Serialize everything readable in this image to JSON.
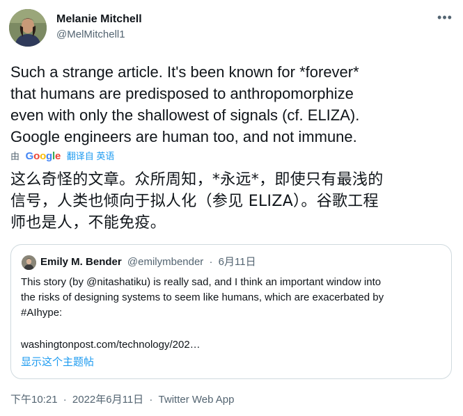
{
  "author": {
    "name": "Melanie Mitchell",
    "handle": "@MelMitchell1"
  },
  "more_glyph": "•••",
  "tweet": {
    "lines": [
      "Such a strange article.  It's been known for *forever*",
      "that humans are predisposed to anthropomorphize",
      "even with only the shallowest of signals (cf. ELIZA).",
      "Google engineers are human too, and not immune."
    ]
  },
  "translation": {
    "by": "由",
    "provider": "Google",
    "action": "翻译自 英语",
    "lines": [
      "这么奇怪的文章。众所周知，*永远*，即使只有最浅的",
      "信号，人类也倾向于拟人化（参见 ELIZA）。谷歌工程",
      "师也是人，不能免疫。"
    ]
  },
  "quote": {
    "name": "Emily M. Bender",
    "handle": "@emilymbender",
    "separator": "·",
    "date": "6月11日",
    "lines": [
      "This story (by @nitashatiku) is really sad, and I think an important window into",
      "the risks of designing systems to seem like humans, which are exacerbated by",
      "#AIhype:"
    ],
    "link": "washingtonpost.com/technology/202…",
    "show_thread": "显示这个主题帖"
  },
  "footer": {
    "time": "下午10:21",
    "separator": "·",
    "date": "2022年6月11日",
    "source": "Twitter Web App"
  },
  "colors": {
    "text": "#0f1419",
    "secondary": "#536471",
    "accent": "#1d9bf0",
    "border": "#cfd9de"
  }
}
